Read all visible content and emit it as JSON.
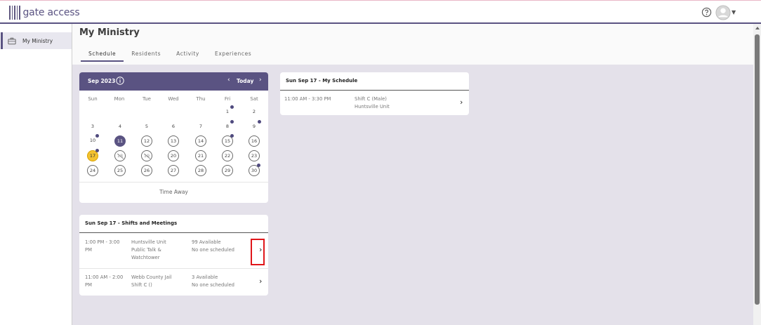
{
  "app": {
    "logo_text": "gate access",
    "help_icon": "help-circle-icon",
    "avatar_icon": "user-avatar-icon"
  },
  "sidebar": {
    "items": [
      {
        "label": "My Ministry",
        "icon": "briefcase-icon"
      }
    ]
  },
  "page": {
    "title": "My Ministry",
    "tabs": [
      {
        "label": "Schedule",
        "active": true
      },
      {
        "label": "Residents",
        "active": false
      },
      {
        "label": "Activity",
        "active": false
      },
      {
        "label": "Experiences",
        "active": false
      }
    ]
  },
  "calendar": {
    "month_label": "Sep 2023",
    "today_label": "Today",
    "weekdays": [
      "Sun",
      "Mon",
      "Tue",
      "Wed",
      "Thu",
      "Fri",
      "Sat"
    ],
    "time_away_label": "Time Away"
  },
  "shifts": {
    "title": "Sun Sep 17 - Shifts and Meetings",
    "rows": [
      {
        "time_line1": "1:00 PM - 3:00",
        "time_line2": "PM",
        "location": "Huntsville Unit",
        "name_line1": "Public Talk &",
        "name_line2": "Watchtower",
        "available": "99 Available",
        "scheduled": "No one scheduled"
      },
      {
        "time_line1": "11:00 AM - 2:00",
        "time_line2": "PM",
        "location": "Webb County Jail",
        "name_line1": "Shift C ()",
        "name_line2": "",
        "available": "3 Available",
        "scheduled": "No one scheduled"
      }
    ]
  },
  "my_schedule": {
    "title": "Sun Sep 17 - My Schedule",
    "rows": [
      {
        "time": "11:00 AM - 3:30 PM",
        "shift": "Shift C (Male)",
        "location": "Huntsville Unit"
      }
    ]
  },
  "colors": {
    "brand": "#5a5382",
    "today_highlight": "#f3c230",
    "content_bg": "#e4e1ea",
    "annotation_box": "#e0161a"
  }
}
